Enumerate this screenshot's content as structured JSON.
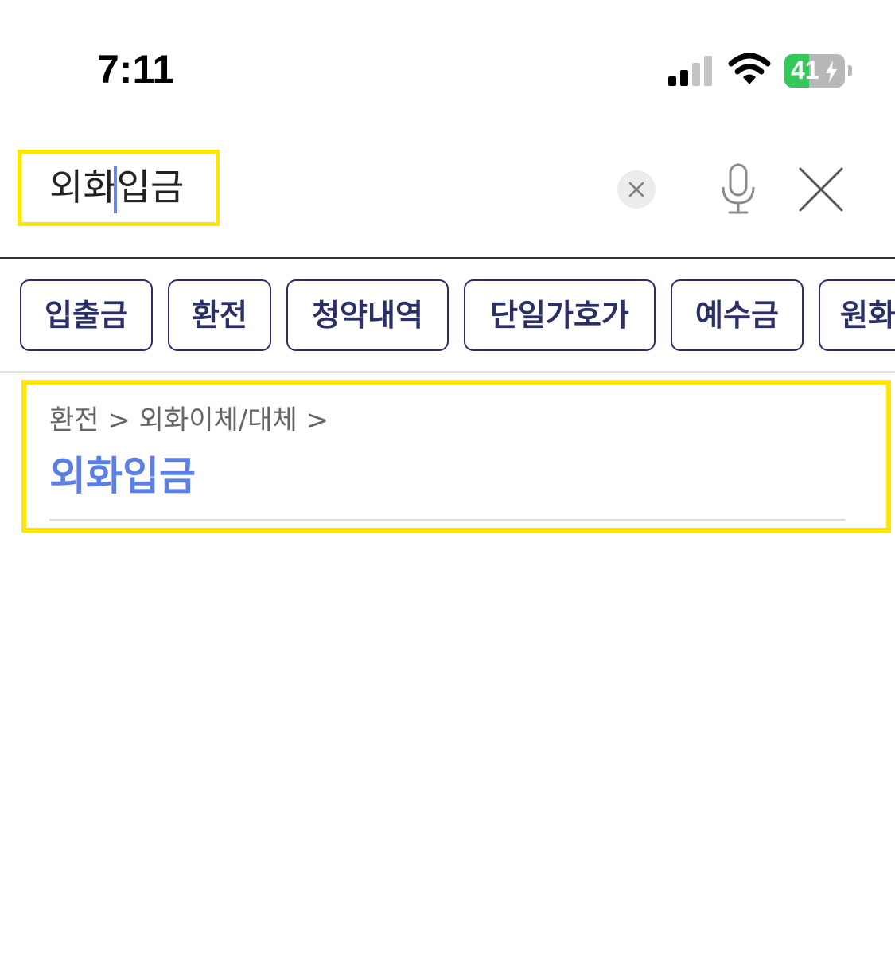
{
  "status_bar": {
    "time": "7:11",
    "battery_percent": "41",
    "battery_level": 0.41,
    "signal_icon": "cellular-signal-icon",
    "wifi_icon": "wifi-icon",
    "battery_icon": "battery-charging-icon"
  },
  "search": {
    "query": "외화입금",
    "clear_icon": "clear-x-icon",
    "mic_icon": "microphone-icon",
    "close_icon": "close-x-icon"
  },
  "chips": [
    {
      "label": "입출금"
    },
    {
      "label": "환전"
    },
    {
      "label": "청약내역"
    },
    {
      "label": "단일가호가"
    },
    {
      "label": "예수금"
    },
    {
      "label": "원화"
    }
  ],
  "result": {
    "path": "환전 > 외화이체/대체 >",
    "title": "외화입금"
  },
  "colors": {
    "highlight_box": "#ffe600",
    "chip_border": "#2a2f66",
    "result_title": "#5b7fe6",
    "battery_green": "#34c759",
    "caret": "#6b86e8"
  }
}
